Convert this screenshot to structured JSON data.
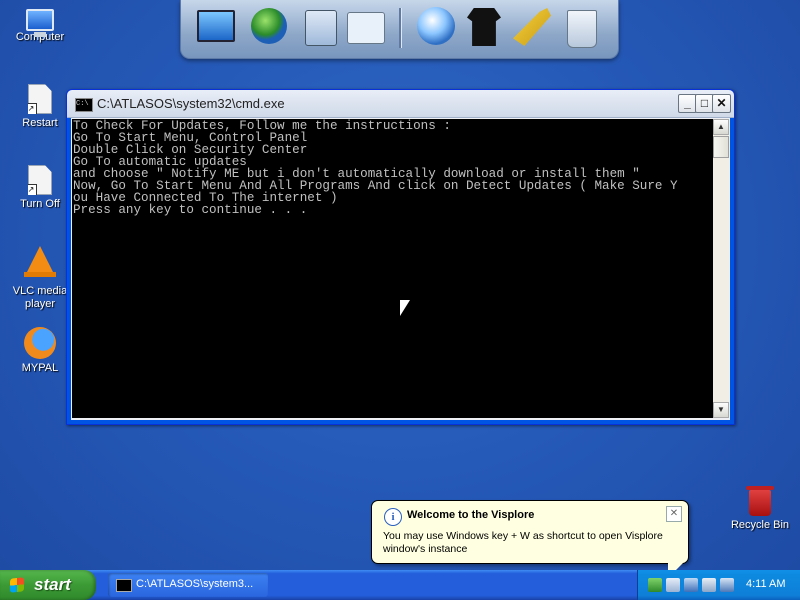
{
  "desktop": {
    "icons": [
      {
        "label": "Computer",
        "icon": "computer-icon"
      },
      {
        "label": "Restart",
        "icon": "shortcut-document-icon"
      },
      {
        "label": "Turn Off",
        "icon": "shortcut-document-icon"
      },
      {
        "label": "VLC media player",
        "icon": "vlc-icon"
      },
      {
        "label": "MYPAL",
        "icon": "firefox-icon"
      },
      {
        "label": "Recycle Bin",
        "icon": "recycle-bin-icon"
      }
    ]
  },
  "dock": {
    "items": [
      "monitor-icon",
      "globe-network-icon",
      "folder-icon",
      "chart-icon",
      "internet-globe-icon",
      "tshirt-icon",
      "tools-icon",
      "recycle-bin-icon"
    ]
  },
  "cmd_window": {
    "title": "C:\\ATLASOS\\system32\\cmd.exe",
    "icon_text": "C:\\",
    "buttons": {
      "minimize": "_",
      "maximize": "□",
      "close": "✕"
    },
    "lines": [
      "To Check For Updates, Follow me the instructions :",
      "Go To Start Menu, Control Panel",
      "Double Click on Security Center",
      "Go To automatic updates",
      "and choose \" Notify ME but i don't automatically download or install them \"",
      "Now, Go To Start Menu And All Programs And click on Detect Updates ( Make Sure Y",
      "ou Have Connected To The internet )",
      "Press any key to continue . . ."
    ],
    "scroll_up": "▲",
    "scroll_down": "▼"
  },
  "balloon": {
    "title": "Welcome to the Visplore",
    "message": "You may use Windows key + W as shortcut to open Visplore window's instance",
    "info_glyph": "i",
    "close_glyph": "✕"
  },
  "taskbar": {
    "start_label": "start",
    "task_label": "C:\\ATLASOS\\system3...",
    "clock": "4:11 AM",
    "tray_icons": [
      "network-icon",
      "volume-icon",
      "display-icon",
      "keyboard-icon",
      "security-icon"
    ]
  }
}
